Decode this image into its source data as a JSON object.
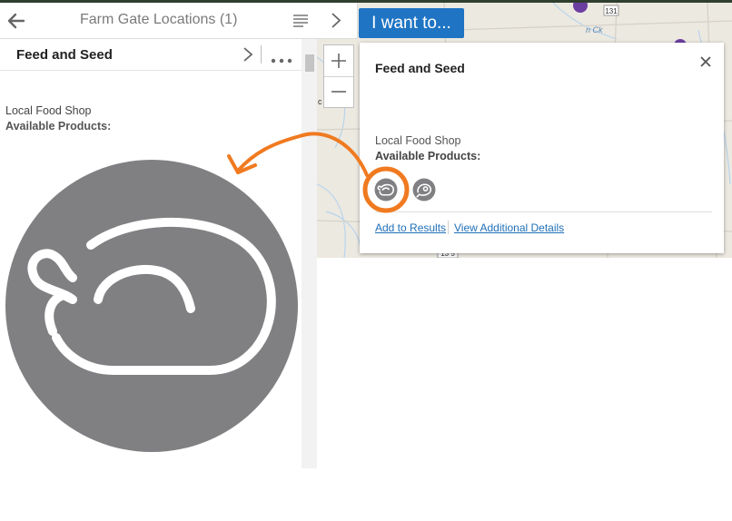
{
  "colors": {
    "brand_blue": "#1f74c3",
    "icon_gray": "#808083",
    "annotation_orange": "#f07a20",
    "link_blue": "#1f6fb8",
    "poi_purple": "#6b3fa0"
  },
  "panel": {
    "title": "Farm Gate Locations (1)",
    "back_icon": "arrow-left-icon",
    "list_icon": "list-icon"
  },
  "feature": {
    "title": "Feed and Seed",
    "type": "Local Food Shop",
    "products_label": "Available Products:",
    "next_icon": "chevron-right-icon",
    "more_icon": "more-icon"
  },
  "map": {
    "toggle_icon": "chevron-right-icon",
    "iwant_label": "I want to...",
    "zoom_in": "+",
    "zoom_out": "−",
    "road_labels": [
      "131",
      "13 5"
    ],
    "map_text": [
      "n Ck",
      "c"
    ]
  },
  "popup": {
    "title": "Feed and Seed",
    "close_icon": "close-icon",
    "type": "Local Food Shop",
    "products_label": "Available Products:",
    "products": [
      {
        "name": "poultry",
        "icon": "poultry-icon"
      },
      {
        "name": "meat",
        "icon": "meat-icon"
      }
    ],
    "links": {
      "add_results": "Add to Results",
      "additional_details": "View Additional Details"
    }
  },
  "annotation": {
    "enlarged_icon": "poultry-icon"
  }
}
